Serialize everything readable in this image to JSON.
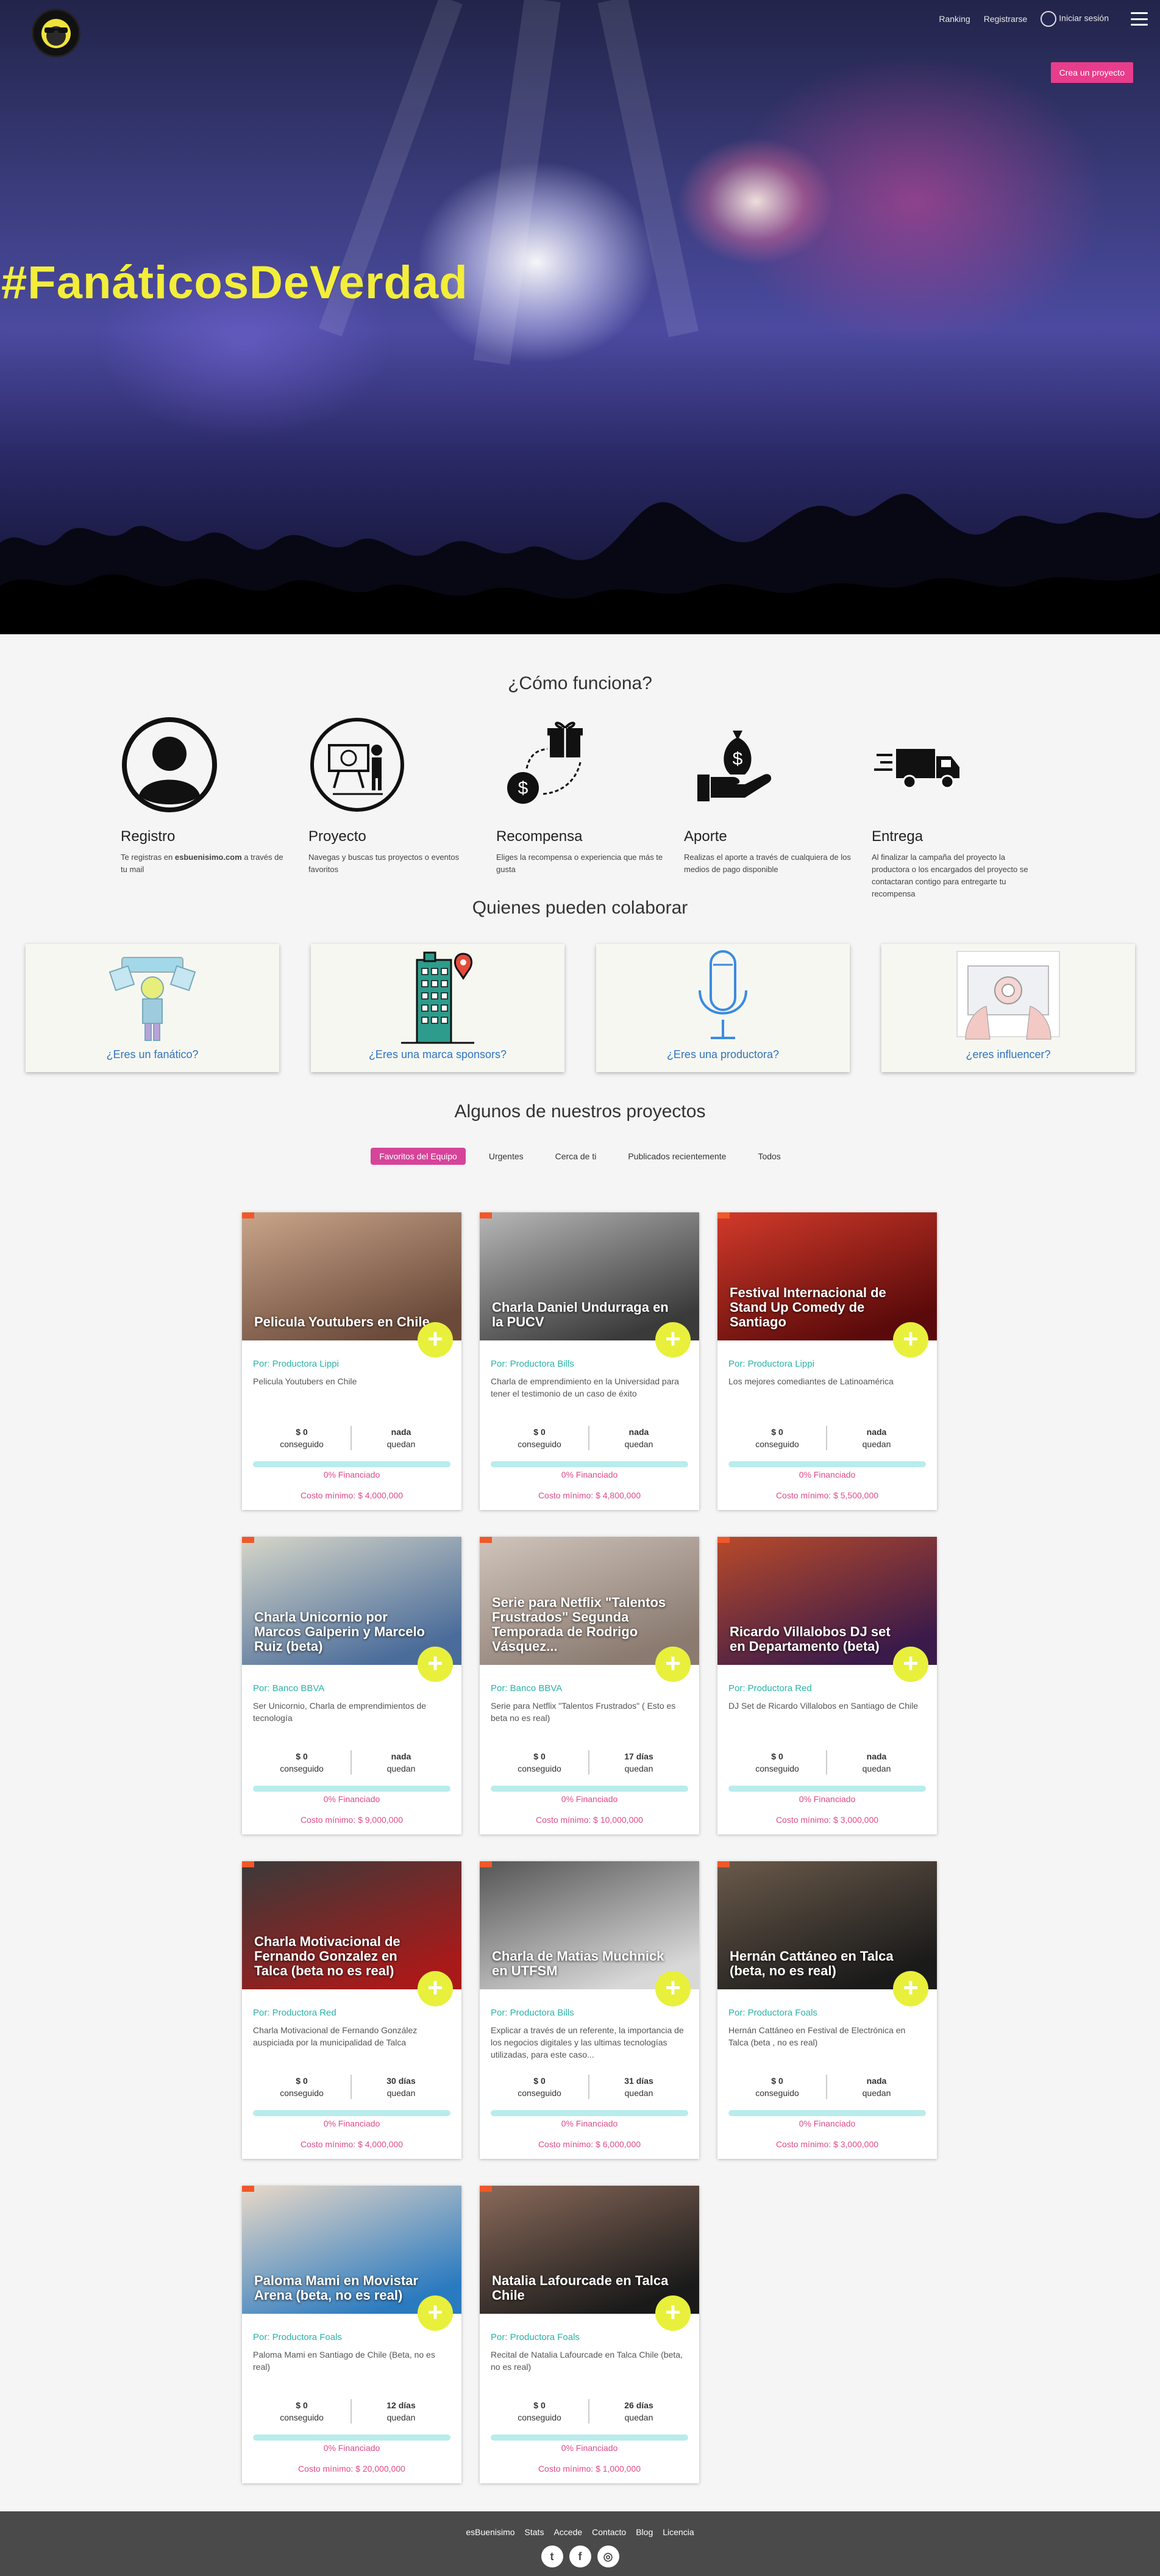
{
  "nav": {
    "ranking": "Ranking",
    "register": "Registrarse",
    "login": "Iniciar sesión",
    "create_project": "Crea un proyecto"
  },
  "hero": {
    "title": "#FanáticosDeVerdad"
  },
  "how": {
    "title": "¿Cómo funciona?",
    "steps": [
      {
        "title": "Registro",
        "desc_pre": "Te registras en ",
        "desc_bold": "esbuenisimo.com",
        "desc_post": " a través de tu mail"
      },
      {
        "title": "Proyecto",
        "desc": "Navegas y buscas tus proyectos o eventos favoritos"
      },
      {
        "title": "Recompensa",
        "desc": "Eliges la recompensa o experiencia que más te gusta"
      },
      {
        "title": "Aporte",
        "desc": "Realizas el aporte a través de cualquiera de los medios de pago disponible"
      },
      {
        "title": "Entrega",
        "desc": "Al finalizar la campaña del proyecto la productora o los encargados del proyecto se contactaran contigo para entregarte tu recompensa"
      }
    ]
  },
  "collab": {
    "title": "Quienes pueden colaborar",
    "cards": [
      "¿Eres un fanático?",
      "¿Eres una marca sponsors?",
      "¿Eres una productora?",
      "¿eres influencer?"
    ]
  },
  "projects": {
    "title": "Algunos de nuestros proyectos",
    "filters": [
      "Favoritos del Equipo",
      "Urgentes",
      "Cerca de ti",
      "Publicados recientemente",
      "Todos"
    ],
    "items": [
      {
        "title": "Pelicula Youtubers en Chile",
        "by": "Por: Productora Lippi",
        "desc": "Pelicula Youtubers en Chile",
        "raised": "$ 0",
        "raised_label": "conseguido",
        "left": "nada",
        "left_label": "quedan",
        "funded": "0% Financiado",
        "min": "Costo mínimo: $ 4,000,000"
      },
      {
        "title": "Charla Daniel Undurraga en la PUCV",
        "by": "Por: Productora Bills",
        "desc": "Charla de emprendimiento en la Universidad para tener el testimonio de un caso de éxito",
        "raised": "$ 0",
        "raised_label": "conseguido",
        "left": "nada",
        "left_label": "quedan",
        "funded": "0% Financiado",
        "min": "Costo mínimo: $ 4,800,000"
      },
      {
        "title": "Festival Internacional de Stand Up Comedy de Santiago",
        "by": "Por: Productora Lippi",
        "desc": "Los mejores comediantes de Latinoamérica",
        "raised": "$ 0",
        "raised_label": "conseguido",
        "left": "nada",
        "left_label": "quedan",
        "funded": "0% Financiado",
        "min": "Costo mínimo: $ 5,500,000"
      },
      {
        "title": "Charla Unicornio por Marcos Galperin y Marcelo Ruiz (beta)",
        "by": "Por: Banco BBVA",
        "desc": "Ser Unicornio, Charla de emprendimientos de tecnología",
        "raised": "$ 0",
        "raised_label": "conseguido",
        "left": "nada",
        "left_label": "quedan",
        "funded": "0% Financiado",
        "min": "Costo mínimo: $ 9,000,000"
      },
      {
        "title": "Serie para Netflix \"Talentos Frustrados\" Segunda Temporada de Rodrigo Vásquez...",
        "by": "Por: Banco BBVA",
        "desc": "Serie para Netflix \"Talentos Frustrados\" ( Esto es beta no es real)",
        "raised": "$ 0",
        "raised_label": "conseguido",
        "left": "17 días",
        "left_label": "quedan",
        "funded": "0% Financiado",
        "min": "Costo mínimo: $ 10,000,000"
      },
      {
        "title": "Ricardo Villalobos DJ set en Departamento (beta)",
        "by": "Por: Productora Red",
        "desc": "DJ Set de Ricardo Villalobos en Santiago de Chile",
        "raised": "$ 0",
        "raised_label": "conseguido",
        "left": "nada",
        "left_label": "quedan",
        "funded": "0% Financiado",
        "min": "Costo mínimo: $ 3,000,000"
      },
      {
        "title": "Charla Motivacional de Fernando Gonzalez en Talca (beta no es real)",
        "by": "Por: Productora Red",
        "desc": "Charla Motivacional de Fernando González auspiciada por la municipalidad de Talca",
        "raised": "$ 0",
        "raised_label": "conseguido",
        "left": "30 días",
        "left_label": "quedan",
        "funded": "0% Financiado",
        "min": "Costo mínimo: $ 4,000,000"
      },
      {
        "title": "Charla de Matias Muchnick en UTFSM",
        "by": "Por: Productora Bills",
        "desc": "Explicar a través de un referente, la importancia de los negocios digitales y las ultimas tecnologías utilizadas, para este caso...",
        "raised": "$ 0",
        "raised_label": "conseguido",
        "left": "31 días",
        "left_label": "quedan",
        "funded": "0% Financiado",
        "min": "Costo mínimo: $ 6,000,000"
      },
      {
        "title": "Hernán Cattáneo en Talca (beta, no es real)",
        "by": "Por: Productora Foals",
        "desc": "Hernán Cattáneo en Festival de Electrónica en Talca (beta , no es real)",
        "raised": "$ 0",
        "raised_label": "conseguido",
        "left": "nada",
        "left_label": "quedan",
        "funded": "0% Financiado",
        "min": "Costo mínimo: $ 3,000,000"
      },
      {
        "title": "Paloma Mami en Movistar Arena (beta, no es real)",
        "by": "Por: Productora Foals",
        "desc": "Paloma Mami en Santiago de Chile (Beta, no es real)",
        "raised": "$ 0",
        "raised_label": "conseguido",
        "left": "12 días",
        "left_label": "quedan",
        "funded": "0% Financiado",
        "min": "Costo mínimo: $ 20,000,000"
      },
      {
        "title": "Natalia Lafourcade en Talca Chile",
        "by": "Por: Productora Foals",
        "desc": "Recital de Natalia Lafourcade en Talca Chile (beta, no es real)",
        "raised": "$ 0",
        "raised_label": "conseguido",
        "left": "26 días",
        "left_label": "quedan",
        "funded": "0% Financiado",
        "min": "Costo mínimo: $ 1,000,000"
      }
    ],
    "plus_symbol": "+"
  },
  "footer": {
    "links": [
      "esBuenisimo",
      "Stats",
      "Accede",
      "Contacto",
      "Blog",
      "Licencia"
    ],
    "social": [
      "twitter-icon",
      "facebook-icon",
      "instagram-icon"
    ]
  }
}
